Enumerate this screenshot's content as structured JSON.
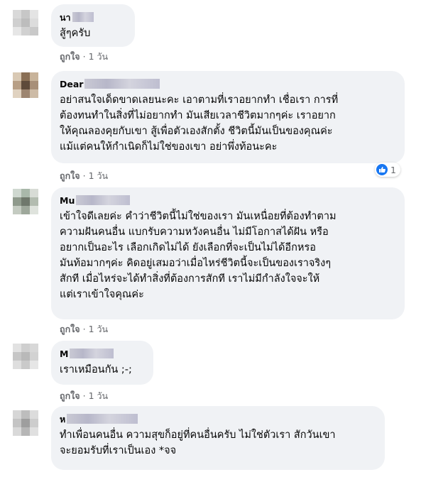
{
  "comments": [
    {
      "name": "นา",
      "text": "สู้ๆครับ",
      "like_label": "ถูกใจ",
      "time": "1 วัน",
      "avatar_colors": [
        "#d9d9d9",
        "#c7c7c7",
        "#e4e4e4",
        "#cfcfcf",
        "#bdbdbd",
        "#dcdcdc",
        "#e6e6e6",
        "#d1d1d1",
        "#c9c9c9"
      ]
    },
    {
      "name": "Dear",
      "text": "อย่าสนใจเด็ดขาดเลยนะคะ เอาตามที่เราอยากทำ เชื่อเรา การที่\nต้องทนทำในสิ่งที่ไม่อยากทำ มันเสียเวลาชีวิตมากๆค่ะ เราอยาก\nให้คุณลองคุยกับเขา สู้เพื่อตัวเองสักตั้ง ชีวิตนี้มันเป็นของคุณค่ะ\nแม้แต่คนให้กำเนิดก็ไม่ใช่ของเขา อย่าพึ่งท้อนะคะ",
      "like_label": "ถูกใจ",
      "time": "1 วัน",
      "reaction_count": "1",
      "reaction_icon": "like-icon",
      "avatar_colors": [
        "#d9c9b4",
        "#8a6f55",
        "#c8b39a",
        "#b89f86",
        "#5e4a3a",
        "#a88f78",
        "#e0d2c0",
        "#9d8570",
        "#cdbba6"
      ]
    },
    {
      "name": "Mu",
      "text": "เข้าใจดีเลยค่ะ คำว่าชีวิตนี้ไม่ใช่ของเรา มันเหนื่อยที่ต้องทำตาม\nความฝันคนอื่น แบกรับความหวังคนอื่น ไม่มีโอกาสได้ฝัน หรือ\nอยากเป็นอะไร เลือกเกิดไม่ได้ ยังเลือกที่จะเป็นไม่ได้อีกหรอ\nมันท้อมากๆค่ะ คิดอยู่เสมอว่าเมื่อไหร่ชีวิตนี้จะเป็นของเราจริงๆ\nสักที เมื่อไหร่จะได้ทำสิ่งที่ต้องการสักที เราไม่มีกำลังใจจะให้\nแต่เราเข้าใจคุณค่ะ",
      "like_label": "ถูกใจ",
      "time": "1 วัน",
      "avatar_colors": [
        "#cfd8d0",
        "#a9b8aa",
        "#d8dcd6",
        "#8f9a8c",
        "#6f786c",
        "#b3bcb0",
        "#c4cbc1",
        "#9ea89b",
        "#dfe3dd"
      ]
    },
    {
      "name": "M",
      "text": "เราเหมือนกัน ;-;",
      "like_label": "ถูกใจ",
      "time": "1 วัน",
      "avatar_colors": [
        "#e2e2e2",
        "#cfcfcf",
        "#d8d8d8",
        "#c6c6c6",
        "#b9b9b9",
        "#d2d2d2",
        "#dedede",
        "#cacaca",
        "#e6e6e6"
      ]
    },
    {
      "name": "ห",
      "text": "ทำเพื่อนคนอื่น ความสุขก็อยู่ที่คนอื่นครับ ไม่ใช่ตัวเรา สักวันเขา\nจะยอมรับที่เราเป็นเอง *จจ",
      "avatar_colors": [
        "#d6d6d6",
        "#bdbdbd",
        "#dcdcdc",
        "#c4c4c4",
        "#9e9e9e",
        "#cdcdcd",
        "#d9d9d9",
        "#b6b6b6",
        "#e0e0e0"
      ]
    }
  ]
}
